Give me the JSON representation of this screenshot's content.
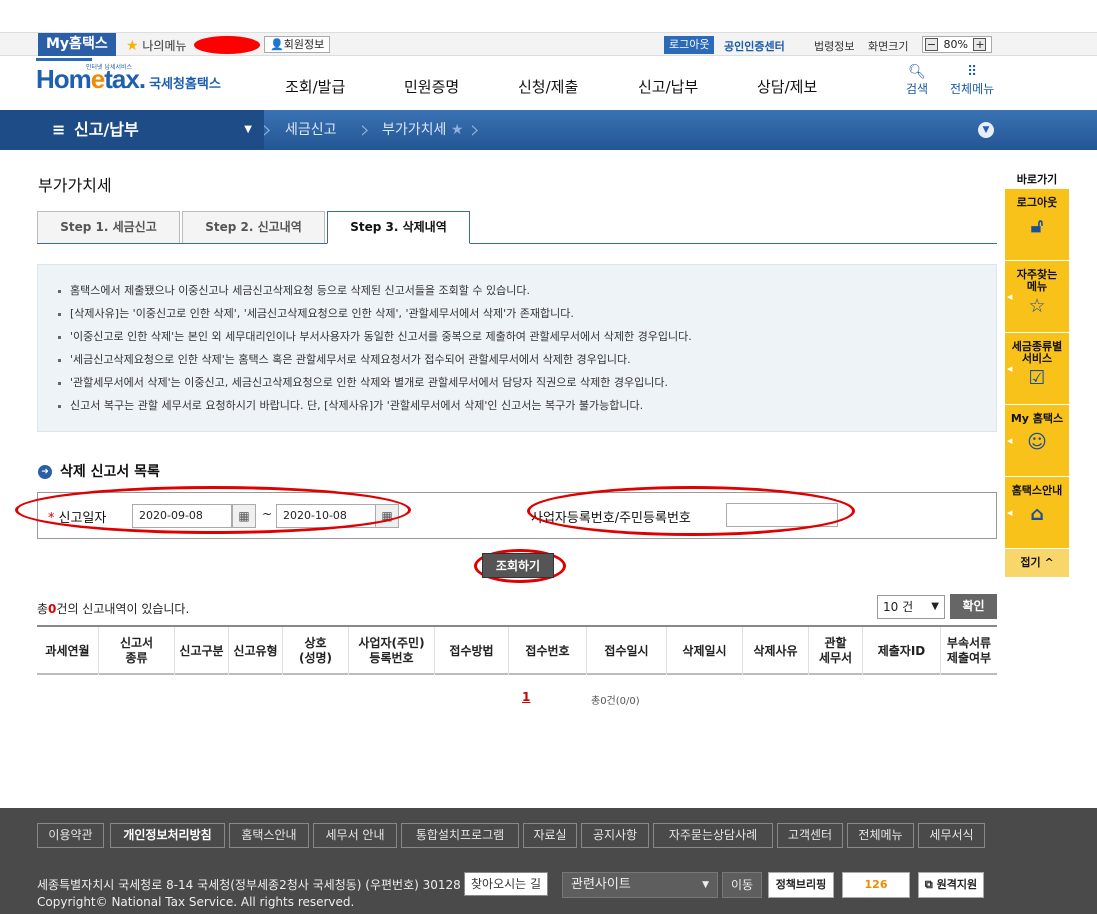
{
  "topbar": {
    "my_hometax": "My홈택스",
    "my_menu": "나의메뉴",
    "member_info": "회원정보",
    "logout": "로그아웃",
    "cert_center": "공인인증센터",
    "law_info": "법령정보",
    "screen_size": "화면크기",
    "zoom_minus": "−",
    "zoom_value": "80%",
    "zoom_plus": "+"
  },
  "header": {
    "logo_main": "Hom",
    "logo_e": "e",
    "logo_tax": "tax.",
    "logo_sub": "국세청홈택스",
    "logo_tiny": "인터넷 납세서비스",
    "gnb": [
      "조회/발급",
      "민원증명",
      "신청/제출",
      "신고/납부",
      "상담/제보"
    ],
    "search_label": "검색",
    "allmenu_label": "전체메뉴"
  },
  "navbar": {
    "main": "신고/납부",
    "crumb1": "세금신고",
    "crumb2": "부가가치세"
  },
  "page": {
    "title": "부가가치세",
    "tabs": [
      "Step 1. 세금신고",
      "Step 2. 신고내역",
      "Step 3. 삭제내역"
    ],
    "info": [
      "홈택스에서 제출됐으나 이중신고나 세금신고삭제요청 등으로 삭제된 신고서들을 조회할 수 있습니다.",
      "[삭제사유]는 '이중신고로 인한 삭제', '세금신고삭제요청으로 인한 삭제', '관할세무서에서 삭제'가 존재합니다.",
      "'이중신고로 인한 삭제'는 본인 외 세무대리인이나 부서사용자가 동일한 신고서를 중복으로 제출하여 관할세무서에서 삭제한 경우입니다.",
      "'세금신고삭제요청으로 인한 삭제'는 홈택스 혹은 관할세무서로 삭제요청서가 접수되어 관할세무서에서 삭제한 경우입니다.",
      "'관할세무서에서 삭제'는 이중신고, 세금신고삭제요청으로 인한 삭제와 별개로 관할세무서에서 담당자 직권으로 삭제한 경우입니다.",
      "신고서 복구는 관할 세무서로 요청하시기 바랍니다. 단, [삭제사유]가 '관할세무서에서 삭제'인 신고서는 복구가 불가능합니다."
    ],
    "section_title": "삭제 신고서 목록",
    "search": {
      "date_label": "신고일자",
      "required_mark": "*",
      "date_from": "2020-09-08",
      "date_to": "2020-10-08",
      "tilde": "~",
      "biz_label": "사업자등록번호/주민등록번호",
      "biz_value": ""
    },
    "search_button": "조회하기",
    "total_prefix": "총",
    "total_count": "0",
    "total_suffix": "건의 신고내역이 있습니다.",
    "page_size": "10 건",
    "confirm": "확인",
    "columns": [
      "과세연월",
      "신고서\n종류",
      "신고구분",
      "신고유형",
      "상호\n(성명)",
      "사업자(주민)\n등록번호",
      "접수방법",
      "접수번호",
      "접수일시",
      "삭제일시",
      "삭제사유",
      "관할\n세무서",
      "제출자ID",
      "부속서류\n제출여부"
    ],
    "pager_current": "1",
    "pager_count": "총0건(0/0)"
  },
  "quick": {
    "header": "바로가기",
    "items": [
      {
        "label": "로그아웃",
        "icon": "unlock-icon"
      },
      {
        "label": "자주찾는\n메뉴",
        "icon": "star-icon"
      },
      {
        "label": "세금종류별\n서비스",
        "icon": "checkbox-icon"
      },
      {
        "label": "My 홈택스",
        "icon": "person-icon"
      },
      {
        "label": "홈택스안내",
        "icon": "house-icon"
      }
    ],
    "fold": "접기"
  },
  "footer": {
    "links": [
      "이용약관",
      "개인정보처리방침",
      "홈택스안내",
      "세무서 안내",
      "통합설치프로그램",
      "자료실",
      "공지사항",
      "자주묻는상담사례",
      "고객센터",
      "전체메뉴",
      "세무서식"
    ],
    "address": "세종특별자치시 국세청로 8-14 국세청(정부세종2청사 국세청동) (우편번호) 30128",
    "directions": "찾아오시는 길",
    "copyright": "Copyright© National Tax Service. All rights reserved.",
    "related_sites": "관련사이트",
    "go": "이동",
    "banner1": "정책브리핑",
    "banner2": "126",
    "banner3": "원격지원"
  },
  "colors": {
    "brand_blue": "#2a5fa8",
    "nav_blue": "#235694",
    "quick_yellow": "#f9c21a",
    "annotation_red": "#e00000"
  }
}
